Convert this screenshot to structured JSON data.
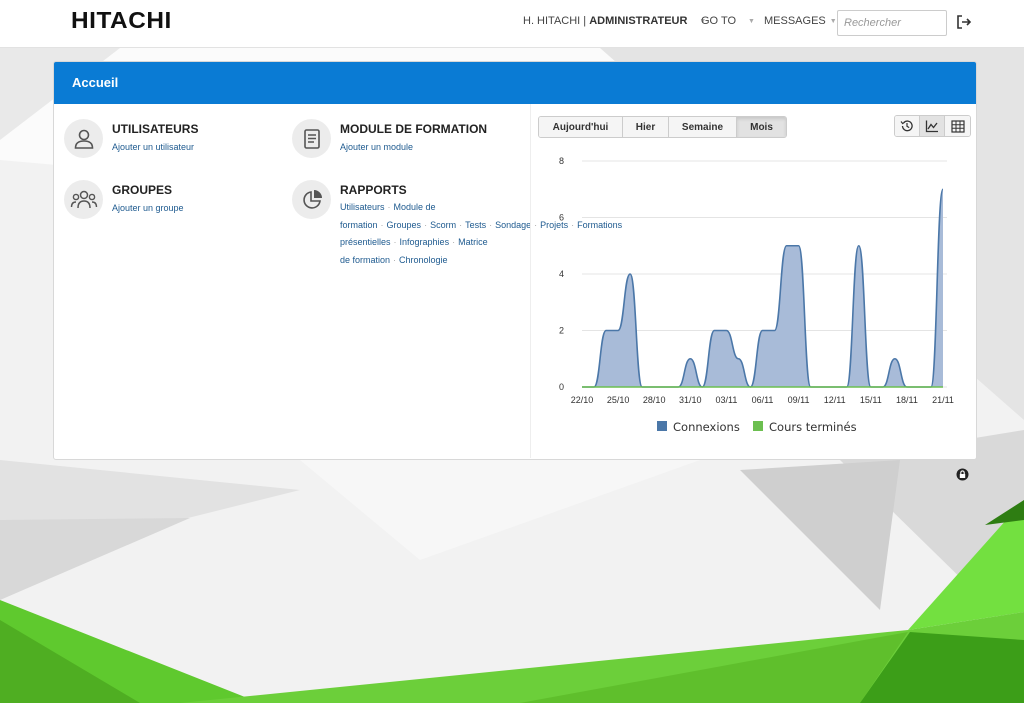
{
  "brand": {
    "logo": "HITACHI"
  },
  "nav": {
    "user_name": "H. HITACHI",
    "user_role": "ADMINISTRATEUR",
    "goto_label": "GO TO",
    "messages_label": "MESSAGES",
    "search_placeholder": "Rechercher"
  },
  "panel": {
    "title": "Accueil",
    "users": {
      "title": "UTILISATEURS",
      "link": "Ajouter un utilisateur"
    },
    "module": {
      "title": "MODULE DE FORMATION",
      "link": "Ajouter un module"
    },
    "groups": {
      "title": "GROUPES",
      "link": "Ajouter un groupe"
    },
    "reports": {
      "title": "RAPPORTS",
      "links": [
        "Utilisateurs",
        "Module de formation",
        "Groupes",
        "Scorm",
        "Tests",
        "Sondage",
        "Projets",
        "Formations présentielles",
        "Infographies",
        "Matrice de formation",
        "Chronologie"
      ]
    }
  },
  "periods": [
    "Aujourd'hui",
    "Hier",
    "Semaine",
    "Mois"
  ],
  "active_period": "Mois",
  "views": [
    "history-icon",
    "area-chart-icon",
    "table-grid-icon"
  ],
  "active_view": "area-chart-icon",
  "colors": {
    "accent": "#0a7bd4",
    "connexions": "#4b77a8",
    "area_fill": "#a8bbd8",
    "cours": "#6cbf50",
    "green_bg": "#5fc92e"
  },
  "chart_data": {
    "type": "area",
    "x": [
      "22/10",
      "23/10",
      "24/10",
      "25/10",
      "26/10",
      "27/10",
      "28/10",
      "29/10",
      "30/10",
      "31/10",
      "01/11",
      "02/11",
      "03/11",
      "04/11",
      "05/11",
      "06/11",
      "07/11",
      "08/11",
      "09/11",
      "10/11",
      "11/11",
      "12/11",
      "13/11",
      "14/11",
      "15/11",
      "16/11",
      "17/11",
      "18/11",
      "19/11",
      "20/11",
      "21/11"
    ],
    "tick_labels": [
      "22/10",
      "25/10",
      "28/10",
      "31/10",
      "03/11",
      "06/11",
      "09/11",
      "12/11",
      "15/11",
      "18/11",
      "21/11"
    ],
    "series": [
      {
        "name": "Connexions",
        "values": [
          0,
          0,
          2,
          2,
          4,
          0,
          0,
          0,
          0,
          1,
          0,
          2,
          2,
          1,
          0,
          2,
          2,
          5,
          5,
          0,
          0,
          0,
          0,
          5,
          0,
          0,
          1,
          0,
          0,
          0,
          7
        ]
      },
      {
        "name": "Cours terminés",
        "values": [
          0,
          0,
          0,
          0,
          0,
          0,
          0,
          0,
          0,
          0,
          0,
          0,
          0,
          0,
          0,
          0,
          0,
          0,
          0,
          0,
          0,
          0,
          0,
          0,
          0,
          0,
          0,
          0,
          0,
          0,
          0
        ]
      }
    ],
    "ylim": [
      0,
      8
    ],
    "yticks": [
      "0",
      "2",
      "4",
      "6",
      "8"
    ],
    "grid": true,
    "legend": "bottom"
  }
}
